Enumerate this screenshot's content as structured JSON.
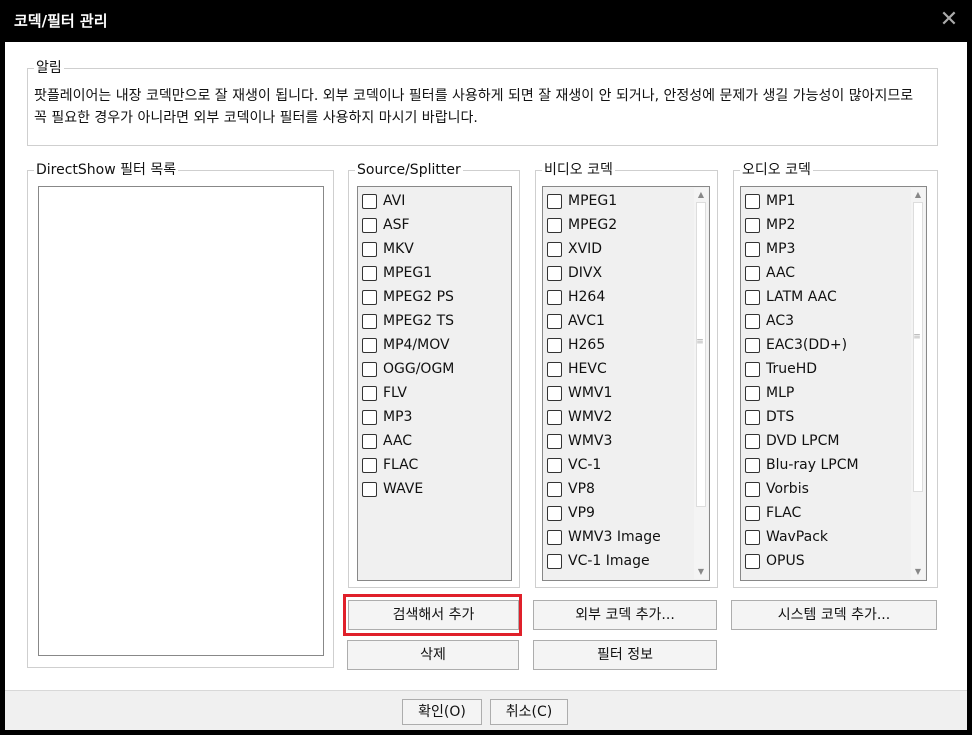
{
  "window": {
    "title": "코덱/필터 관리",
    "close_glyph": "✕"
  },
  "notice": {
    "legend": "알림",
    "text": "팟플레이어는 내장 코덱만으로 잘 재생이 됩니다. 외부 코덱이나 필터를 사용하게 되면 잘 재생이 안 되거나, 안정성에 문제가 생길 가능성이 많아지므로 꼭 필요한 경우가 아니라면 외부 코덱이나 필터를 사용하지 마시기 바랍니다."
  },
  "directshow": {
    "legend": "DirectShow 필터 목록"
  },
  "source_splitter": {
    "legend": "Source/Splitter",
    "items": [
      "AVI",
      "ASF",
      "MKV",
      "MPEG1",
      "MPEG2 PS",
      "MPEG2 TS",
      "MP4/MOV",
      "OGG/OGM",
      "FLV",
      "MP3",
      "AAC",
      "FLAC",
      "WAVE"
    ]
  },
  "video_codec": {
    "legend": "비디오 코덱",
    "items": [
      "MPEG1",
      "MPEG2",
      "XVID",
      "DIVX",
      "H264",
      "AVC1",
      "H265",
      "HEVC",
      "WMV1",
      "WMV2",
      "WMV3",
      "VC-1",
      "VP8",
      "VP9",
      "WMV3 Image",
      "VC-1 Image"
    ]
  },
  "audio_codec": {
    "legend": "오디오 코덱",
    "items": [
      "MP1",
      "MP2",
      "MP3",
      "AAC",
      "LATM AAC",
      "AC3",
      "EAC3(DD+)",
      "TrueHD",
      "MLP",
      "DTS",
      "DVD LPCM",
      "Blu-ray LPCM",
      "Vorbis",
      "FLAC",
      "WavPack",
      "OPUS"
    ]
  },
  "buttons": {
    "search_add": "검색해서 추가",
    "delete": "삭제",
    "external_codec_add": "외부 코덱 추가...",
    "filter_info": "필터 정보",
    "system_codec_add": "시스템 코덱 추가...",
    "ok": "확인(O)",
    "cancel": "취소(C)"
  },
  "colors": {
    "highlight": "#e0202a",
    "titlebar": "#000000"
  }
}
